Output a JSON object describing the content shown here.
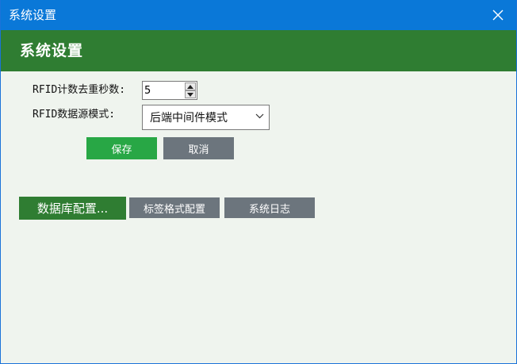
{
  "window": {
    "title": "系统设置"
  },
  "header": {
    "heading": "系统设置"
  },
  "form": {
    "dedup_label": "RFID计数去重秒数:",
    "dedup_value": "5",
    "source_label": "RFID数据源模式:",
    "source_selected": "后端中间件模式"
  },
  "actions": {
    "save_label": "保存",
    "cancel_label": "取消"
  },
  "tabs": [
    {
      "label": "数据库配置..."
    },
    {
      "label": "标签格式配置"
    },
    {
      "label": "系统日志"
    }
  ],
  "colors": {
    "titlebar": "#0a78d8",
    "header_band": "#2f7d32",
    "save_button": "#28a745",
    "secondary_button": "#6c757d",
    "background": "#eff4ee"
  },
  "icons": {
    "close": "close-icon",
    "spin_up": "triangle-up-icon",
    "spin_down": "triangle-down-icon",
    "dropdown": "chevron-down-icon"
  }
}
